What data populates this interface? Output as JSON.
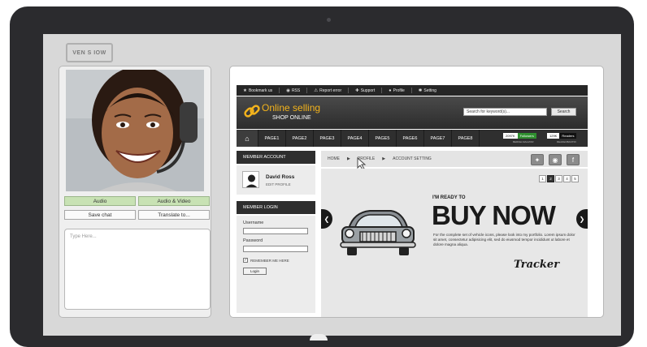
{
  "app": {
    "logo_text": "VEN S IOW"
  },
  "left": {
    "audio_label": "Audio",
    "audio_video_label": "Audio & Video",
    "save_chat_label": "Save chat",
    "translate_label": "Translate to...",
    "chat_placeholder": "Type Here..."
  },
  "site": {
    "topbar": [
      {
        "icon": "star-icon",
        "label": "Bookmark us"
      },
      {
        "icon": "rss-icon",
        "label": "RSS"
      },
      {
        "icon": "warning-icon",
        "label": "Report error"
      },
      {
        "icon": "support-icon",
        "label": "Support"
      },
      {
        "icon": "user-icon",
        "label": "Profile"
      },
      {
        "icon": "gear-icon",
        "label": "Setting"
      }
    ],
    "brand": {
      "title": "Online selling",
      "subtitle": "SHOP ONLINE",
      "accent": "#f3b31c"
    },
    "search": {
      "placeholder": "Search for keyword(s)...",
      "button": "Search"
    },
    "nav": [
      "PAGE1",
      "PAGE2",
      "PAGE3",
      "PAGE4",
      "PAGE5",
      "PAGE6",
      "PAGE7",
      "PAGE8"
    ],
    "followers": {
      "count": "2097K",
      "label": "Followers",
      "sub": "BERKELSIALIZOR"
    },
    "readers": {
      "count": "129K",
      "label": "Readers",
      "sub": "READEOBANTRI"
    },
    "member_account": {
      "heading": "MEMBER ACCOUNT",
      "name": "David Ross",
      "edit": "EDIT PROFILE"
    },
    "member_login": {
      "heading": "MEMBER LOGIN",
      "username_label": "Username",
      "password_label": "Password",
      "remember_label": "REMEMBER ME HERE",
      "login_button": "Login"
    },
    "breadcrumb": [
      "HOME",
      "PROFILE",
      "ACCOUNT SETTING"
    ],
    "banner": {
      "pages": [
        "1",
        "2",
        "3",
        "4",
        "5"
      ],
      "active_page": "2",
      "ready": "I'M READY TO",
      "headline": "BUY NOW",
      "body": "For the complete set of vehicle icons, please look into my portfolio. Lorem ipsum dolor sit amet, consectetur adipisicing elit, sed do eiusmod tempor incididunt ut labore et dolore magna aliqua.",
      "brand": "Tracker"
    }
  }
}
